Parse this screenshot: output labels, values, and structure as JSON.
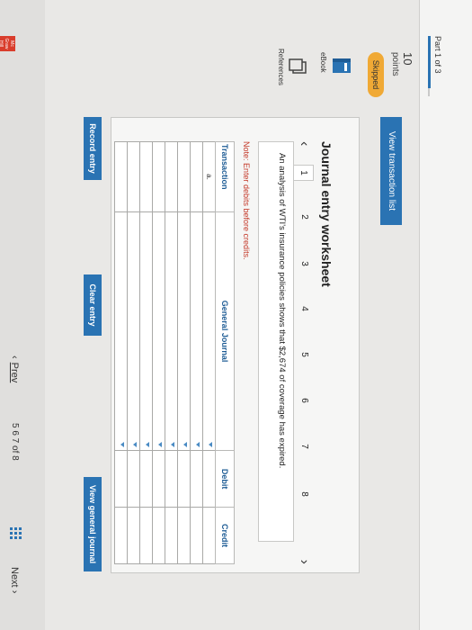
{
  "header": {
    "part_label": "Part 1 of 3"
  },
  "left_panel": {
    "points_value": "10",
    "points_label": "points",
    "status_badge": "Skipped",
    "ebook_label": "eBook",
    "references_label": "References"
  },
  "view_transaction_list": "View transaction list",
  "worksheet": {
    "title": "Journal entry worksheet",
    "pages": [
      "1",
      "2",
      "3",
      "4",
      "5",
      "6",
      "7",
      "8"
    ],
    "active_page": "1",
    "description": "An analysis of WTI's insurance policies shows that $2,674 of coverage has expired.",
    "note": "Note: Enter debits before credits.",
    "columns": [
      "Transaction",
      "General Journal",
      "Debit",
      "Credit"
    ],
    "first_transaction": "a."
  },
  "buttons": {
    "record_entry": "Record entry",
    "clear_entry": "Clear entry",
    "view_general_journal": "View general journal"
  },
  "bottom_nav": {
    "prev": "Prev",
    "pages": "5  6  7  of 8",
    "next": "Next"
  },
  "colors": {
    "accent": "#2a73b3",
    "badge": "#f0a935",
    "note": "#c43a2a"
  }
}
